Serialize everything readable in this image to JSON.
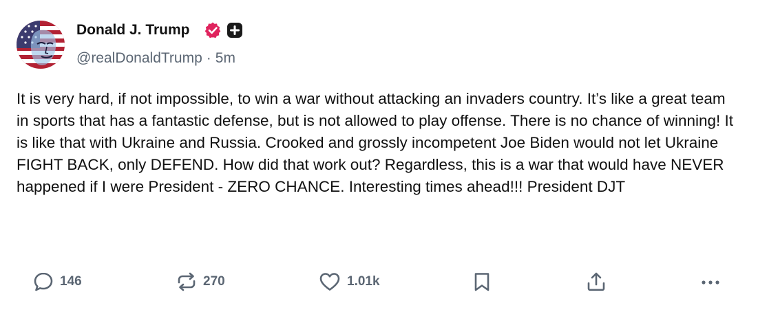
{
  "author": {
    "display_name": "Donald J. Trump",
    "handle": "@realDonaldTrump",
    "separator": "·",
    "time": "5m",
    "avatar_icon": "american-flag-face-avatar",
    "verified_color": "#e0245e"
  },
  "post": {
    "text": "It is very hard, if not impossible, to win a war without attacking an invaders country. It’s like a great team in sports that has a fantastic defense, but is not allowed to play offense. There is no chance of winning! It is like that with Ukraine and Russia. Crooked and grossly incompetent Joe Biden would not let Ukraine FIGHT BACK, only DEFEND. How did that work out? Regardless, this is a war that would have NEVER happened if I were President - ZERO CHANCE. Interesting times ahead!!! President DJT"
  },
  "actions": {
    "reply": {
      "icon": "reply-icon",
      "count": "146"
    },
    "repost": {
      "icon": "repost-icon",
      "count": "270"
    },
    "like": {
      "icon": "heart-icon",
      "count": "1.01k"
    },
    "bookmark": {
      "icon": "bookmark-icon"
    },
    "share": {
      "icon": "share-icon"
    },
    "more": {
      "icon": "more-icon"
    }
  }
}
